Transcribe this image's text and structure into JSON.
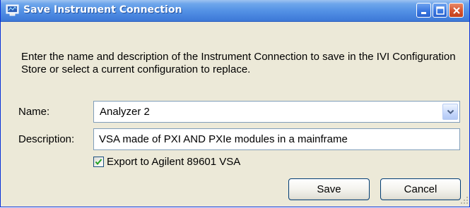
{
  "window": {
    "title": "Save Instrument Connection",
    "icon": "instrument-connection-icon",
    "controls": [
      "minimize-icon",
      "maximize-icon",
      "close-icon"
    ]
  },
  "prompt": "Enter the name and description of the Instrument Connection to save in the IVI Configuration Store or select a current configuration to replace.",
  "name_field": {
    "label": "Name:",
    "value": "Analyzer 2",
    "icon": "chevron-down-icon"
  },
  "description_field": {
    "label": "Description:",
    "value": "VSA made of PXI AND PXIe modules in a mainframe"
  },
  "export_checkbox": {
    "label": "Export to Agilent 89601 VSA",
    "checked": true
  },
  "buttons": {
    "save": "Save",
    "cancel": "Cancel"
  },
  "colors": {
    "titlebar": "#4a87e0",
    "window_background": "#ece9d8",
    "close_button": "#d6532f",
    "field_border": "#7f9db9"
  }
}
